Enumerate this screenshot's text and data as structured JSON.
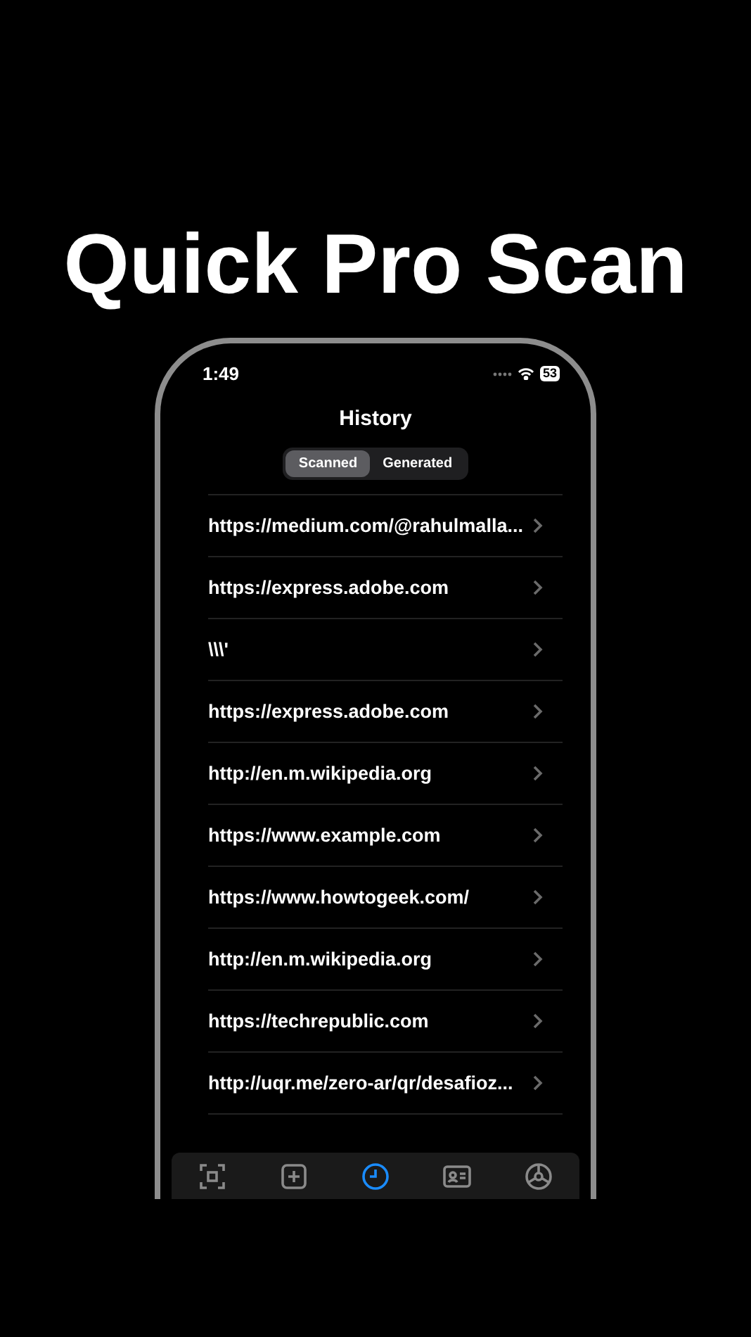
{
  "headline": "Quick Pro Scan",
  "status_bar": {
    "time": "1:49",
    "battery": "53"
  },
  "screen": {
    "title": "History"
  },
  "segments": [
    {
      "label": "Scanned",
      "selected": true
    },
    {
      "label": "Generated",
      "selected": false
    }
  ],
  "history": [
    {
      "text": "https://medium.com/@rahulmalla..."
    },
    {
      "text": "https://express.adobe.com"
    },
    {
      "text": "\\\\\\'"
    },
    {
      "text": "https://express.adobe.com"
    },
    {
      "text": "http://en.m.wikipedia.org"
    },
    {
      "text": "https://www.example.com"
    },
    {
      "text": "https://www.howtogeek.com/"
    },
    {
      "text": "http://en.m.wikipedia.org"
    },
    {
      "text": "https://techrepublic.com"
    },
    {
      "text": "http://uqr.me/zero-ar/qr/desafioz..."
    }
  ],
  "tab_bar": [
    {
      "kind": "scan",
      "selected": false
    },
    {
      "kind": "create",
      "selected": false
    },
    {
      "kind": "history",
      "selected": true
    },
    {
      "kind": "business",
      "selected": false
    },
    {
      "kind": "settings",
      "selected": false
    }
  ]
}
